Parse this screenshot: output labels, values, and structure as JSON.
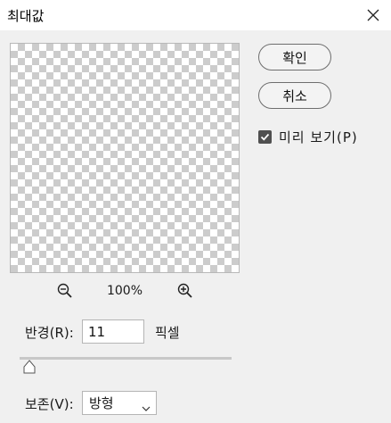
{
  "window": {
    "title": "최대값"
  },
  "buttons": {
    "ok": "확인",
    "cancel": "취소"
  },
  "preview_checkbox": {
    "label": "미리 보기(P)",
    "checked": true
  },
  "zoom": {
    "level": "100%"
  },
  "radius": {
    "label": "반경(R):",
    "value": "11",
    "unit": "픽셀",
    "slider_fraction": 0.05
  },
  "preserve": {
    "label": "보존(V):",
    "selected": "방형"
  },
  "icons": [
    "close-icon",
    "zoom-out-icon",
    "zoom-in-icon",
    "checkmark-icon",
    "slider-thumb",
    "chevron-down-icon"
  ]
}
